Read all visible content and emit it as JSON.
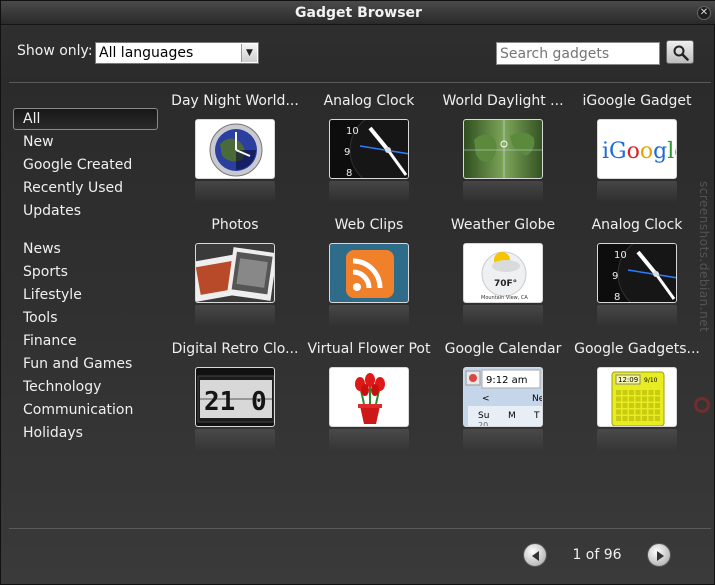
{
  "window": {
    "title": "Gadget Browser"
  },
  "filter": {
    "show_only_label": "Show only:",
    "language_selected": "All languages",
    "search_placeholder": "Search gadgets"
  },
  "sidebar": {
    "groups": [
      [
        "All",
        "New",
        "Google Created",
        "Recently Used",
        "Updates"
      ],
      [
        "News",
        "Sports",
        "Lifestyle",
        "Tools",
        "Finance",
        "Fun and Games",
        "Technology",
        "Communication",
        "Holidays"
      ]
    ],
    "selected": "All"
  },
  "gadgets": [
    {
      "name": "Day Night World...",
      "thumb": "globe-clock"
    },
    {
      "name": "Analog Clock",
      "thumb": "analog-clock"
    },
    {
      "name": "World Daylight ...",
      "thumb": "daylight-map"
    },
    {
      "name": "iGoogle Gadget",
      "thumb": "igoogle-logo"
    },
    {
      "name": "Photos",
      "thumb": "photos"
    },
    {
      "name": "Web Clips",
      "thumb": "rss"
    },
    {
      "name": "Weather Globe",
      "thumb": "weather-globe",
      "texts": [
        "70F°",
        "Mountain View, CA"
      ]
    },
    {
      "name": "Analog Clock",
      "thumb": "analog-clock"
    },
    {
      "name": "Digital Retro Clo...",
      "thumb": "retro-clock",
      "texts": [
        "21 0"
      ]
    },
    {
      "name": "Virtual Flower Pot",
      "thumb": "flower-pot"
    },
    {
      "name": "Google Calendar",
      "thumb": "calendar",
      "texts": [
        "9:12 am",
        "<",
        "Ne",
        "Su",
        "M",
        "T",
        "20"
      ]
    },
    {
      "name": "Google Gadgets...",
      "thumb": "gadgets-calendar",
      "texts": [
        "12:09",
        "9/10"
      ]
    }
  ],
  "igoogle": {
    "letters": [
      "i",
      "G",
      "o",
      "o",
      "g",
      "l",
      "e"
    ]
  },
  "pager": {
    "text": "1 of 96"
  },
  "watermark": "screenshots.debian.net",
  "colors": {
    "accent_blue": "#1e6bd6",
    "selected_border": "#8a8a8a"
  }
}
